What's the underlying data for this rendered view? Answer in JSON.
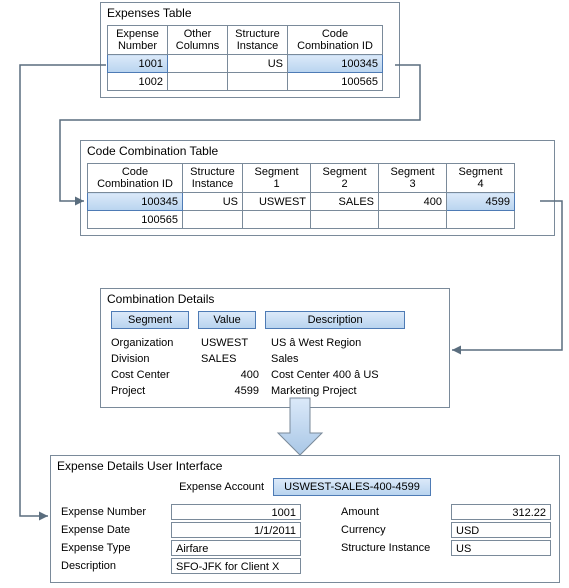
{
  "expenses_table": {
    "title": "Expenses Table",
    "headers": {
      "h0": "Expense\nNumber",
      "h1": "Other\nColumns",
      "h2": "Structure\nInstance",
      "h3": "Code\nCombination ID"
    },
    "rows": [
      {
        "expense_no": "1001",
        "other": "",
        "struct": "US",
        "ccid": "100345"
      },
      {
        "expense_no": "1002",
        "other": "",
        "struct": "",
        "ccid": "100565"
      }
    ]
  },
  "cc_table": {
    "title": "Code Combination Table",
    "headers": {
      "h0": "Code\nCombination ID",
      "h1": "Structure\nInstance",
      "h2": "Segment\n1",
      "h3": "Segment\n2",
      "h4": "Segment\n3",
      "h5": "Segment\n4"
    },
    "rows": [
      {
        "ccid": "100345",
        "struct": "US",
        "s1": "USWEST",
        "s2": "SALES",
        "s3": "400",
        "s4": "4599"
      },
      {
        "ccid": "100565",
        "struct": "",
        "s1": "",
        "s2": "",
        "s3": "",
        "s4": ""
      }
    ]
  },
  "combo_details": {
    "title": "Combination Details",
    "headers": {
      "h0": "Segment",
      "h1": "Value",
      "h2": "Description"
    },
    "rows": [
      {
        "seg": "Organization",
        "val": "USWEST",
        "desc": "US â West Region"
      },
      {
        "seg": "Division",
        "val": "SALES",
        "desc": "Sales"
      },
      {
        "seg": "Cost Center",
        "val": "400",
        "desc": "Cost Center 400 â US"
      },
      {
        "seg": "Project",
        "val": "4599",
        "desc": "Marketing Project"
      }
    ]
  },
  "expense_ui": {
    "title": "Expense Details User Interface",
    "account_label": "Expense Account",
    "account_value": "USWEST-SALES-400-4599",
    "left_fields": [
      {
        "label": "Expense Number",
        "value": "1001",
        "align": "right"
      },
      {
        "label": "Expense Date",
        "value": "1/1/2011",
        "align": "right"
      },
      {
        "label": "Expense Type",
        "value": "Airfare",
        "align": "left"
      },
      {
        "label": "Description",
        "value": "SFO-JFK for Client X",
        "align": "left"
      }
    ],
    "right_fields": [
      {
        "label": "Amount",
        "value": "312.22",
        "align": "right"
      },
      {
        "label": "Currency",
        "value": "USD",
        "align": "left"
      },
      {
        "label": "Structure Instance",
        "value": "US",
        "align": "left"
      }
    ]
  }
}
